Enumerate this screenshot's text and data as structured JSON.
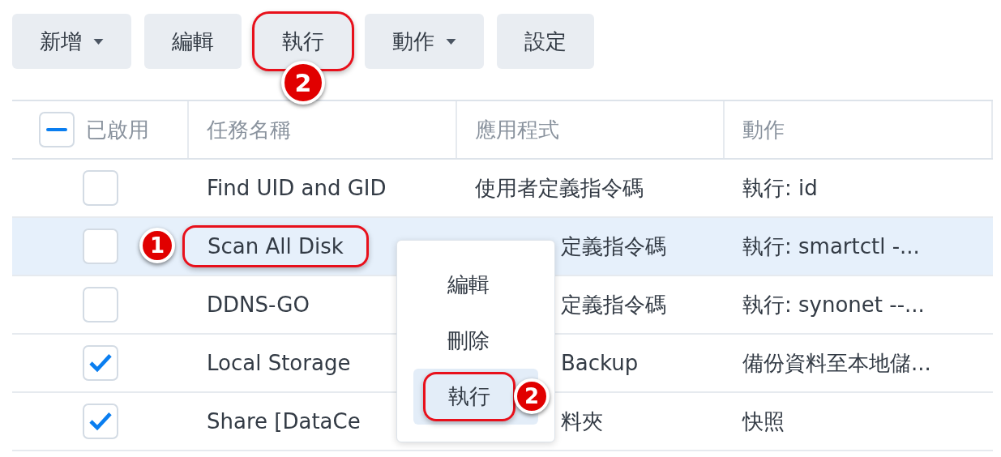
{
  "toolbar": [
    {
      "label": "新增",
      "dropdown": true
    },
    {
      "label": "編輯",
      "dropdown": false
    },
    {
      "label": "執行",
      "dropdown": false,
      "highlight": {
        "badge": "2"
      }
    },
    {
      "label": "動作",
      "dropdown": true
    },
    {
      "label": "設定",
      "dropdown": false
    }
  ],
  "table": {
    "select_all": {
      "indeterminate": true
    },
    "columns": [
      {
        "label": "已啟用",
        "kind": "check"
      },
      {
        "label": "任務名稱",
        "kind": "text"
      },
      {
        "label": "應用程式",
        "kind": "text"
      },
      {
        "label": "動作",
        "kind": "text"
      }
    ],
    "rows": [
      {
        "enabled": false,
        "selected": false,
        "name": "Find UID and GID",
        "app": "使用者定義指令碼",
        "action": "執行: id"
      },
      {
        "enabled": false,
        "selected": true,
        "name": "Scan All Disk",
        "name_highlight": {
          "badge": "1"
        },
        "app": "定義指令碼",
        "app_partly_hidden": true,
        "action": "執行: smartctl -..."
      },
      {
        "enabled": false,
        "selected": false,
        "name": "DDNS-GO",
        "app": "定義指令碼",
        "app_partly_hidden": true,
        "action": "執行: synonet --..."
      },
      {
        "enabled": true,
        "selected": false,
        "name": "Local Storage",
        "app": "Backup",
        "app_partly_hidden": true,
        "action": "備份資料至本地儲..."
      },
      {
        "enabled": true,
        "selected": false,
        "name": "Share [DataCe",
        "app": "料夾",
        "app_partly_hidden": true,
        "action": "快照"
      }
    ]
  },
  "context_menu": {
    "items": [
      {
        "label": "編輯",
        "selected": false
      },
      {
        "label": "刪除",
        "selected": false
      },
      {
        "label": "執行",
        "selected": true,
        "highlight": {
          "badge": "2"
        }
      }
    ]
  }
}
